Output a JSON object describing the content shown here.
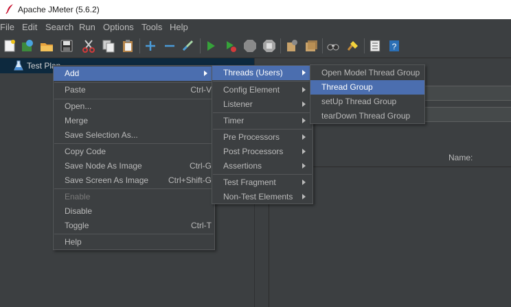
{
  "window": {
    "title": "Apache JMeter (5.6.2)"
  },
  "menubar": [
    "File",
    "Edit",
    "Search",
    "Run",
    "Options",
    "Tools",
    "Help"
  ],
  "tree": {
    "root_label": "Test Plan"
  },
  "table": {
    "name_header": "Name:"
  },
  "context_menu": {
    "add": "Add",
    "paste": "Paste",
    "paste_shortcut": "Ctrl-V",
    "open": "Open...",
    "merge": "Merge",
    "save_selection": "Save Selection As...",
    "copy_code": "Copy Code",
    "save_node_image": "Save Node As Image",
    "save_node_image_shortcut": "Ctrl-G",
    "save_screen_image": "Save Screen As Image",
    "save_screen_image_shortcut": "Ctrl+Shift-G",
    "enable": "Enable",
    "disable": "Disable",
    "toggle": "Toggle",
    "toggle_shortcut": "Ctrl-T",
    "help": "Help"
  },
  "add_submenu": {
    "threads": "Threads (Users)",
    "config_element": "Config Element",
    "listener": "Listener",
    "timer": "Timer",
    "pre_processors": "Pre Processors",
    "post_processors": "Post Processors",
    "assertions": "Assertions",
    "test_fragment": "Test Fragment",
    "non_test_elements": "Non-Test Elements"
  },
  "threads_submenu": {
    "open_model": "Open Model Thread Group",
    "thread_group": "Thread Group",
    "setup": "setUp Thread Group",
    "teardown": "tearDown Thread Group"
  },
  "colors": {
    "selection": "#4b6eaf",
    "background": "#3c3f41",
    "tree_selection": "#0d293e"
  }
}
